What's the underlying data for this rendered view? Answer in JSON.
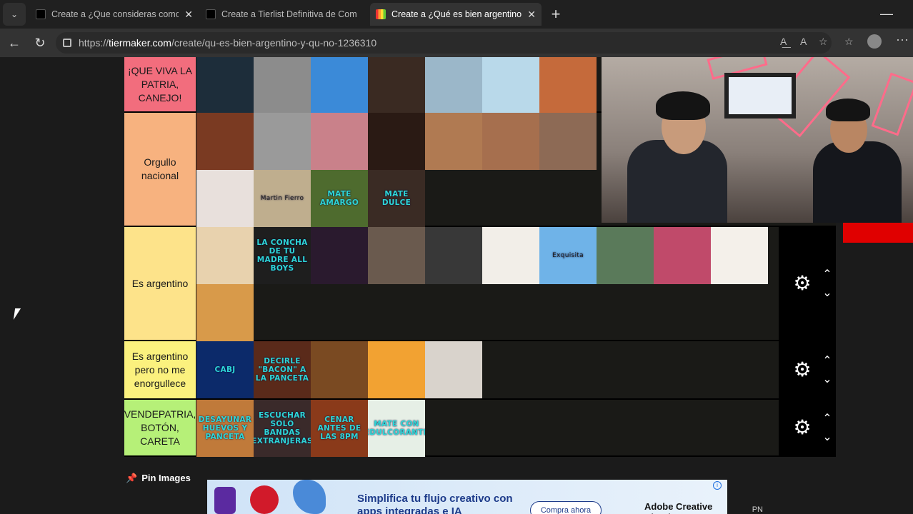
{
  "browser": {
    "tabs": [
      {
        "title": "Create a ¿Que consideras como in",
        "active": false
      },
      {
        "title": "Create a Tierlist Definitiva de Com",
        "active": false
      },
      {
        "title": "Create a ¿Qué es bien argentino y",
        "active": true
      }
    ],
    "url_prefix": "https://",
    "url_domain": "tiermaker.com",
    "url_path": "/create/qu-es-bien-argentino-y-qu-no-1236310",
    "icons": {
      "menu": "chevron-down-icon",
      "close": "close-icon",
      "new_tab": "plus-icon",
      "minimize": "minimize-icon",
      "back": "back-arrow-icon",
      "reload": "reload-icon",
      "lock": "lock-icon",
      "read_aloud": "read-aloud-icon",
      "text_size": "text-size-icon",
      "favorite": "star-icon",
      "favorites": "favorites-icon",
      "profile": "avatar-icon",
      "more": "more-icon"
    },
    "glyphs": {
      "menu": "⌄",
      "close": "✕",
      "new_tab": "+",
      "minimize": "—",
      "back": "←",
      "reload": "↻",
      "more": "⋯",
      "read_aloud": "A͟",
      "text_size": "A",
      "favorite": "☆",
      "favorites": "☆",
      "gear": "⚙",
      "up": "⌃",
      "down": "⌄",
      "pin": "📌",
      "ad_info": "i"
    }
  },
  "tiers": [
    {
      "label": "¡QUE VIVA LA PATRIA, CANEJO!",
      "color": "#f26d7d",
      "items": [
        {
          "name": "islas-malvinas-map",
          "bg": "#1d2d3a",
          "caption": ""
        },
        {
          "name": "san-martin-portrait",
          "bg": "#8c8c8c",
          "caption": ""
        },
        {
          "name": "maradona-photo",
          "bg": "#3b8ad8",
          "caption": ""
        },
        {
          "name": "messi-photo",
          "bg": "#3a2a22",
          "caption": ""
        },
        {
          "name": "cataratas-iguazu",
          "bg": "#9bb7c9",
          "caption": ""
        },
        {
          "name": "glaciar-perito-moreno",
          "bg": "#b9d9ea",
          "caption": ""
        },
        {
          "name": "choripan-photo",
          "bg": "#c56a3b",
          "caption": ""
        }
      ]
    },
    {
      "label": "Orgullo nacional",
      "color": "#f7b27f",
      "items": [
        {
          "name": "asado-photo",
          "bg": "#7a3a22",
          "caption": ""
        },
        {
          "name": "borges-portrait",
          "bg": "#9a9a9a",
          "caption": ""
        },
        {
          "name": "casa-rosada",
          "bg": "#c9818a",
          "caption": ""
        },
        {
          "name": "fernet-bottle",
          "bg": "#2a1a14",
          "caption": ""
        },
        {
          "name": "celebrity-face-1",
          "bg": "#b07a52",
          "caption": ""
        },
        {
          "name": "celebrity-face-2",
          "bg": "#a66f4e",
          "caption": ""
        },
        {
          "name": "celebrity-face-3",
          "bg": "#8d6a55",
          "caption": ""
        },
        {
          "name": "alfajores-box",
          "bg": "#e8e0dc",
          "caption": ""
        },
        {
          "name": "martin-fierro-book",
          "bg": "#bfae8e",
          "caption": "Martin Fierro"
        },
        {
          "name": "mate-amargo",
          "bg": "#4e6b2e",
          "caption": "MATE AMARGO"
        },
        {
          "name": "mate-dulce",
          "bg": "#3a2b24",
          "caption": "MATE DULCE"
        }
      ]
    },
    {
      "label": "Es argentino",
      "color": "#fde38a",
      "items": [
        {
          "name": "alfajor-photo",
          "bg": "#e8d2ae",
          "caption": ""
        },
        {
          "name": "meme-heart-text",
          "bg": "#1e1e1e",
          "caption": "LA CONCHA DE TU MADRE ALL BOYS"
        },
        {
          "name": "wrestler-image",
          "bg": "#2a1a2e",
          "caption": ""
        },
        {
          "name": "curly-hair-person",
          "bg": "#6a5a4e",
          "caption": ""
        },
        {
          "name": "streamer-headset",
          "bg": "#383838",
          "caption": ""
        },
        {
          "name": "cookbook-cover",
          "bg": "#f2eee8",
          "caption": ""
        },
        {
          "name": "exquisita-box",
          "bg": "#6fb3e8",
          "caption": "Exquisita"
        },
        {
          "name": "young-man-photo",
          "bg": "#5a7a5a",
          "caption": ""
        },
        {
          "name": "carnaval-dancers",
          "bg": "#c04a6a",
          "caption": ""
        },
        {
          "name": "pan-galleta-photo",
          "bg": "#f4f0ea",
          "caption": ""
        },
        {
          "name": "medialunas-photo",
          "bg": "#d89a4a",
          "caption": ""
        }
      ]
    },
    {
      "label": "Es argentino pero no me enorgullece",
      "color": "#fbf17e",
      "items": [
        {
          "name": "boca-juniors-crest",
          "bg": "#0c2a6a",
          "caption": "CABJ"
        },
        {
          "name": "decirle-bacon-a-la-panceta",
          "bg": "#5a2a1a",
          "caption": "DECIRLE \"BACON\" A LA PANCETA"
        },
        {
          "name": "chocotorta-slice",
          "bg": "#7a4a22",
          "caption": ""
        },
        {
          "name": "mafalda-cartoon",
          "bg": "#f2a232",
          "caption": ""
        },
        {
          "name": "bearded-man-photo",
          "bg": "#d9d3cc",
          "caption": ""
        }
      ]
    },
    {
      "label": "VENDEPATRIA, BOTÓN, CARETA",
      "color": "#b6f078",
      "items": [
        {
          "name": "desayunar-huevos-y-panceta",
          "bg": "#c07a3a",
          "caption": "DESAYUNAR HUEVOS Y PANCETA"
        },
        {
          "name": "escuchar-solo-bandas-extranjeras",
          "bg": "#3a2a2a",
          "caption": "ESCUCHAR SOLO BANDAS EXTRANJERAS"
        },
        {
          "name": "cenar-antes-de-las-8pm",
          "bg": "#8a3a1a",
          "caption": "CENAR ANTES DE LAS 8PM"
        },
        {
          "name": "agua-bottle-meme",
          "bg": "#e6efe6",
          "caption": "MATE CON EDULCORANTE"
        }
      ]
    }
  ],
  "pin_label": "Pin Images",
  "ad": {
    "headline": "Simplifica tu flujo creativo con apps integradas e IA",
    "cta": "Compra ahora",
    "brand": "Adobe Creative Cloud P"
  },
  "corner_text": "PN"
}
